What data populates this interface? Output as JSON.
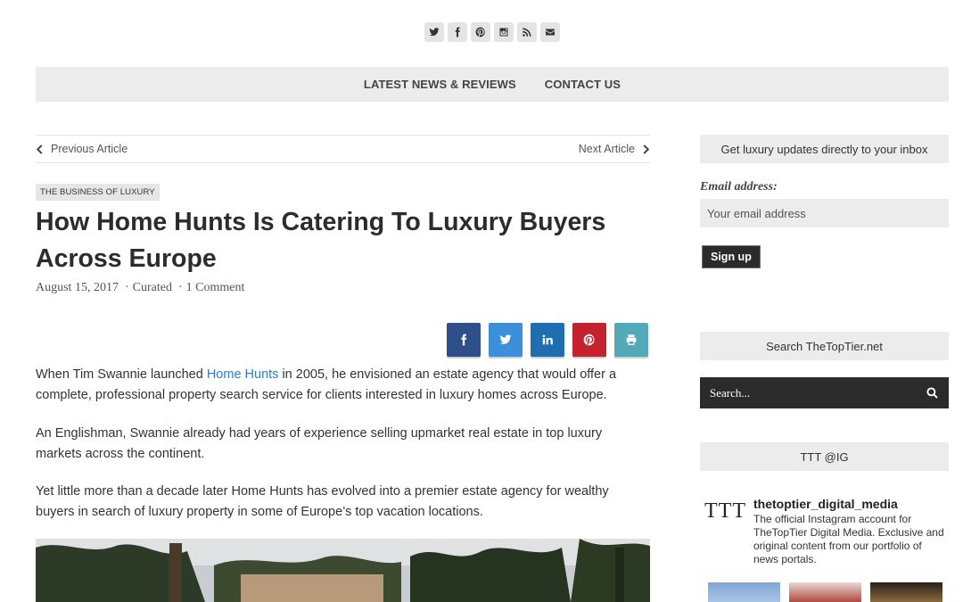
{
  "social_top": [
    "twitter-icon",
    "facebook-icon",
    "pinterest-icon",
    "instagram-icon",
    "rss-icon",
    "envelope-icon"
  ],
  "nav": {
    "items": [
      "LATEST NEWS & REVIEWS",
      "CONTACT US"
    ]
  },
  "article_nav": {
    "previous": "Previous Article",
    "next": "Next Article"
  },
  "article": {
    "category": "THE BUSINESS OF LUXURY",
    "title": "How Home Hunts Is Catering To Luxury Buyers Across Europe",
    "date": "August 15, 2017",
    "author": "Curated",
    "comments": "1 Comment",
    "para1_before": "When Tim Swannie launched ",
    "para1_link": "Home Hunts",
    "para1_after": " in 2005, he envisioned an estate agency that would offer a complete, professional property search service for clients interested in luxury homes across Europe.",
    "para2": "An Englishman, Swannie already had years of experience selling upmarket real estate in top luxury markets across the continent.",
    "para3": "Yet little more than a decade later Home Hunts has evolved into a premier estate agency for wealthy buyers in search of luxury property in some of Europe’s top vacation locations."
  },
  "share_colors": {
    "facebook": "#2f4f8a",
    "twitter": "#3d8fd9",
    "linkedin": "#1f6fb0",
    "pinterest": "#c4222c",
    "print": "#52aab8"
  },
  "sidebar": {
    "newsletter_title": "Get luxury updates directly to your inbox",
    "email_label": "Email address:",
    "email_placeholder": "Your email address",
    "signup": "Sign up",
    "search_title": "Search TheTopTier.net",
    "search_placeholder": "Search...",
    "ig_title": "TTT @IG",
    "ig_logo": "TTT",
    "ig_name": "thetoptier_digital_media",
    "ig_desc": "The official Instagram account for TheTopTier Digital Media. Exclusive and original content from our portfolio of news portals."
  }
}
